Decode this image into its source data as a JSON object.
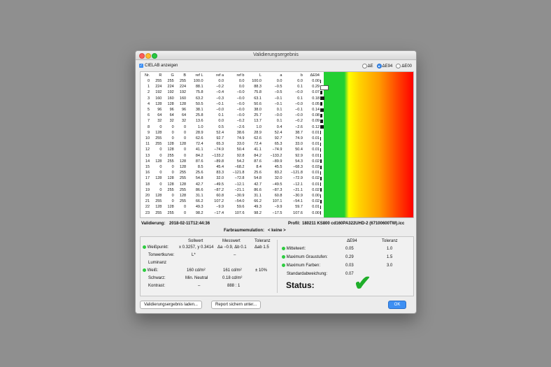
{
  "window": {
    "title": "Validierungsergebnis"
  },
  "options": {
    "cielab_checkbox_label": "CIELAB anzeigen",
    "radios": [
      {
        "label": "ΔE",
        "selected": false
      },
      {
        "label": "ΔE94",
        "selected": true
      },
      {
        "label": "ΔE00",
        "selected": false
      }
    ]
  },
  "table": {
    "headers": [
      "Nr.",
      "R",
      "G",
      "B",
      "ref L",
      "ref a",
      "ref b",
      "L",
      "a",
      "b",
      "ΔE94"
    ],
    "rows": [
      [
        "0",
        "255",
        "255",
        "255",
        "100.0",
        "0.0",
        "0.0",
        "100.0",
        "0.0",
        "0.0",
        "0.00"
      ],
      [
        "1",
        "224",
        "224",
        "224",
        "88.1",
        "−0.2",
        "0.0",
        "88.3",
        "−0.5",
        "0.1",
        "0.29"
      ],
      [
        "2",
        "192",
        "192",
        "192",
        "75.8",
        "−0.4",
        "−0.0",
        "75.8",
        "−0.5",
        "−0.0",
        "0.07"
      ],
      [
        "3",
        "160",
        "160",
        "160",
        "63.2",
        "−0.3",
        "−0.0",
        "63.1",
        "−0.1",
        "0.1",
        "0.18"
      ],
      [
        "4",
        "128",
        "128",
        "128",
        "50.5",
        "−0.1",
        "−0.0",
        "50.6",
        "−0.1",
        "−0.0",
        "0.05"
      ],
      [
        "5",
        "96",
        "96",
        "96",
        "38.1",
        "−0.0",
        "−0.0",
        "38.0",
        "0.1",
        "−0.1",
        "0.14"
      ],
      [
        "6",
        "64",
        "64",
        "64",
        "25.8",
        "0.1",
        "−0.0",
        "25.7",
        "−0.0",
        "−0.0",
        "0.08"
      ],
      [
        "7",
        "32",
        "32",
        "32",
        "13.6",
        "0.0",
        "−0.2",
        "13.7",
        "0.1",
        "−0.2",
        "0.09"
      ],
      [
        "8",
        "0",
        "0",
        "0",
        "1.0",
        "0.5",
        "−2.6",
        "1.0",
        "0.4",
        "−2.6",
        "0.12"
      ],
      [
        "9",
        "128",
        "0",
        "0",
        "28.9",
        "52.4",
        "38.6",
        "28.9",
        "52.4",
        "38.7",
        "0.01"
      ],
      [
        "10",
        "255",
        "0",
        "0",
        "62.6",
        "92.7",
        "74.9",
        "62.6",
        "92.7",
        "74.9",
        "0.01"
      ],
      [
        "11",
        "255",
        "128",
        "128",
        "72.4",
        "65.3",
        "33.0",
        "72.4",
        "65.3",
        "33.0",
        "0.01"
      ],
      [
        "12",
        "0",
        "128",
        "0",
        "41.1",
        "−74.9",
        "50.4",
        "41.1",
        "−74.9",
        "50.4",
        "0.01"
      ],
      [
        "13",
        "0",
        "255",
        "0",
        "84.2",
        "−133.2",
        "92.8",
        "84.2",
        "−133.2",
        "92.9",
        "0.01"
      ],
      [
        "14",
        "128",
        "255",
        "128",
        "87.6",
        "−89.8",
        "54.2",
        "87.6",
        "−89.9",
        "54.3",
        "0.02"
      ],
      [
        "15",
        "0",
        "0",
        "128",
        "8.5",
        "45.4",
        "−68.2",
        "8.4",
        "45.5",
        "−68.3",
        "0.03"
      ],
      [
        "16",
        "0",
        "0",
        "255",
        "25.6",
        "83.3",
        "−121.8",
        "25.6",
        "83.2",
        "−121.8",
        "0.01"
      ],
      [
        "17",
        "128",
        "128",
        "255",
        "54.8",
        "32.0",
        "−72.8",
        "54.8",
        "32.0",
        "−72.9",
        "0.02"
      ],
      [
        "18",
        "0",
        "128",
        "128",
        "42.7",
        "−49.5",
        "−12.1",
        "42.7",
        "−49.5",
        "−12.1",
        "0.01"
      ],
      [
        "19",
        "0",
        "255",
        "255",
        "86.6",
        "−87.2",
        "−21.1",
        "86.6",
        "−87.3",
        "−21.1",
        "0.02"
      ],
      [
        "20",
        "128",
        "0",
        "128",
        "31.1",
        "60.8",
        "−30.9",
        "31.1",
        "60.8",
        "−30.9",
        "0.00"
      ],
      [
        "21",
        "255",
        "0",
        "255",
        "66.2",
        "107.2",
        "−54.0",
        "66.2",
        "107.1",
        "−54.1",
        "0.02"
      ],
      [
        "22",
        "128",
        "128",
        "0",
        "49.3",
        "−9.9",
        "59.6",
        "49.3",
        "−9.9",
        "59.7",
        "0.01"
      ],
      [
        "23",
        "255",
        "255",
        "0",
        "98.2",
        "−17.4",
        "107.6",
        "98.2",
        "−17.5",
        "107.6",
        "0.00"
      ]
    ]
  },
  "info": {
    "validation_label": "Validierung:",
    "validation_date": "2018-02-11T12:44:36",
    "profile_label": "Profil:",
    "profile_value": "180211 KS800 cd160PA322UHD-2 (67100600TW).icc",
    "emulation_label": "Farbraumemulation:",
    "emulation_value": "< keine >"
  },
  "left_panel": {
    "col_sollwert": "Sollwert",
    "col_messwert": "Messwert",
    "col_toleranz": "Toleranz",
    "weisspunkt_label": "Weißpunkt:",
    "weisspunkt_soll": "x 0.3257, y 0.3414",
    "weisspunkt_mess": "Δa −0.9, Δb 0.1",
    "weisspunkt_tol": "Δab 1.5",
    "tonwert_label": "Tonwertkurve:",
    "tonwert_soll": "L*",
    "tonwert_mess": "–",
    "luminanz_label": "Luminanz",
    "weiss_label": "Weiß:",
    "weiss_soll": "160 cd/m²",
    "weiss_mess": "161 cd/m²",
    "weiss_tol": "± 10%",
    "schwarz_label": "Schwarz:",
    "schwarz_soll": "Min. Neutral",
    "schwarz_mess": "0.18 cd/m²",
    "kontrast_label": "Kontrast:",
    "kontrast_soll": "–",
    "kontrast_mess": "888 : 1"
  },
  "right_panel": {
    "col_de": "ΔE94",
    "col_tol": "Toleranz",
    "mittel_label": "Mittelwert:",
    "mittel_value": "0.05",
    "mittel_tol": "1.0",
    "grau_label": "Maximum Graustufen:",
    "grau_value": "0.29",
    "grau_tol": "1.5",
    "farben_label": "Maximum Farben:",
    "farben_value": "0.03",
    "farben_tol": "3.0",
    "std_label": "Standardabweichung:",
    "std_value": "0.07",
    "status_label": "Status:",
    "status_icon": "check-icon"
  },
  "buttons": {
    "load": "Validierungsergebnis laden...",
    "save": "Report sichern unter...",
    "ok": "OK"
  },
  "colors": {
    "accent": "#3d8ff3",
    "pass_green": "#1fae2a",
    "status_dot": "#2ecc40"
  }
}
